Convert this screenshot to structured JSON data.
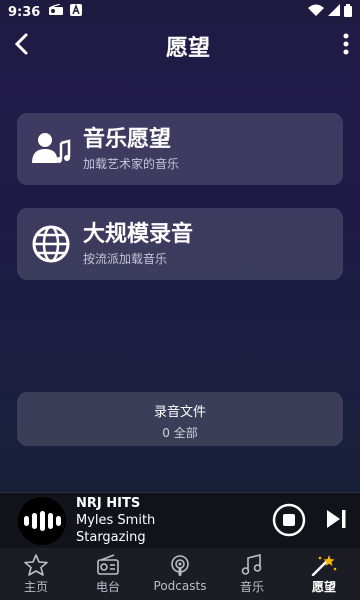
{
  "status": {
    "time": "9:36"
  },
  "header": {
    "title": "愿望"
  },
  "cards": [
    {
      "title": "音乐愿望",
      "subtitle": "加载艺术家的音乐",
      "icon": "user-music-icon"
    },
    {
      "title": "大规模录音",
      "subtitle": "按流派加载音乐",
      "icon": "globe-icon"
    }
  ],
  "files": {
    "title": "录音文件",
    "count": "0 全部"
  },
  "player": {
    "station": "NRJ HITS",
    "artist": "Myles Smith",
    "track": "Stargazing"
  },
  "nav": [
    {
      "label": "主页",
      "icon": "star-icon"
    },
    {
      "label": "电台",
      "icon": "radio-icon"
    },
    {
      "label": "Podcasts",
      "icon": "podcast-icon"
    },
    {
      "label": "音乐",
      "icon": "music-note-icon"
    },
    {
      "label": "愿望",
      "icon": "magic-wand-icon"
    }
  ],
  "colors": {
    "background": "#211b48",
    "card": "#3a3560",
    "active": "#ffffff",
    "wand_star": "#f5b800"
  }
}
